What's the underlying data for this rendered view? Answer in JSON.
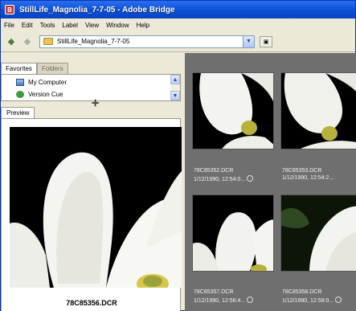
{
  "window": {
    "title": "StillLife_Magnolia_7-7-05 - Adobe Bridge",
    "app_icon": "adobe-bridge-icon"
  },
  "menu": [
    "File",
    "Edit",
    "Tools",
    "Label",
    "View",
    "Window",
    "Help"
  ],
  "toolbar": {
    "back_icon": "back-arrow-icon",
    "forward_icon": "forward-arrow-icon",
    "path": "StillLife_Magnolia_7-7-05",
    "dropdown_icon": "chevron-down-icon"
  },
  "tabs": {
    "favorites": "Favorites",
    "folders": "Folders",
    "preview": "Preview"
  },
  "favorites": [
    {
      "label": "My Computer",
      "icon": "computer-icon"
    },
    {
      "label": "Version Cue",
      "icon": "version-cue-icon"
    }
  ],
  "preview": {
    "caption": "78C85356.DCR"
  },
  "thumbnails": [
    {
      "name": "78C85352.DCR",
      "meta": "1/12/1990, 12:54:0..."
    },
    {
      "name": "78C85353.DCR",
      "meta": "1/12/1990, 12:54:2..."
    },
    {
      "name": "78C85357.DCR",
      "meta": "1/12/1990, 12:56:4..."
    },
    {
      "name": "78C85358.DCR",
      "meta": "1/12/1990, 12:58:0..."
    }
  ],
  "colors": {
    "title_bar": "#0a4fd6",
    "chrome": "#ece9d8",
    "content_bg": "#6f6f6f"
  }
}
